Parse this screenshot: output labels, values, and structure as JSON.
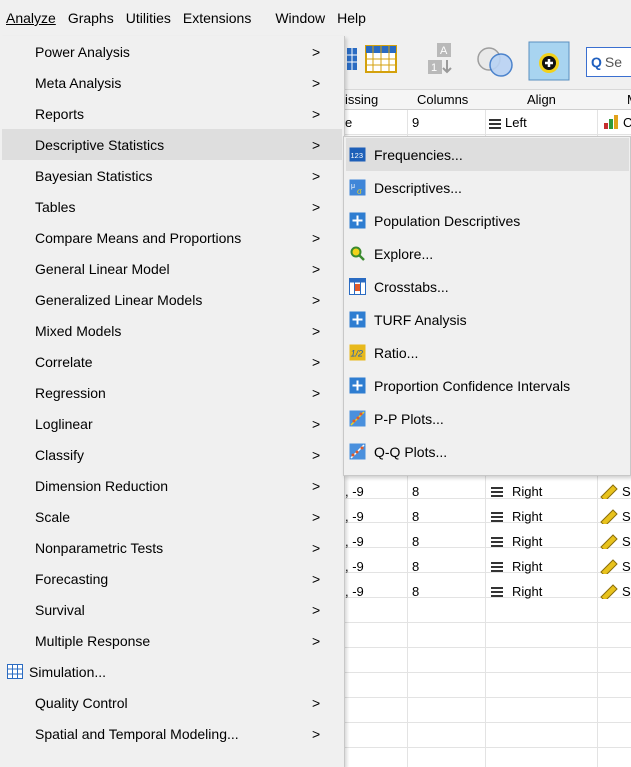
{
  "menubar": {
    "items": [
      "Analyze",
      "Graphs",
      "Utilities",
      "Extensions",
      "Window",
      "Help"
    ]
  },
  "toolbar": {
    "search_placeholder": "Se"
  },
  "grid": {
    "headers": [
      "issing",
      "Columns",
      "Align",
      "M"
    ],
    "first_row": {
      "missing": "e",
      "columns": "9",
      "align": "Left",
      "measure": "C"
    },
    "rows": [
      {
        "missing": ", -9",
        "columns": "8",
        "align": "Right",
        "measure": "S"
      },
      {
        "missing": ", -9",
        "columns": "8",
        "align": "Right",
        "measure": "S"
      },
      {
        "missing": ", -9",
        "columns": "8",
        "align": "Right",
        "measure": "S"
      },
      {
        "missing": ", -9",
        "columns": "8",
        "align": "Right",
        "measure": "S"
      },
      {
        "missing": ", -9",
        "columns": "8",
        "align": "Right",
        "measure": "S"
      }
    ]
  },
  "analyze_menu": {
    "items": [
      {
        "label": "Power Analysis",
        "submenu": true
      },
      {
        "label": "Meta Analysis",
        "submenu": true
      },
      {
        "label": "Reports",
        "submenu": true
      },
      {
        "label": "Descriptive Statistics",
        "submenu": true,
        "highlighted": true
      },
      {
        "label": "Bayesian Statistics",
        "submenu": true
      },
      {
        "label": "Tables",
        "submenu": true
      },
      {
        "label": "Compare Means and Proportions",
        "submenu": true
      },
      {
        "label": "General Linear Model",
        "submenu": true
      },
      {
        "label": "Generalized Linear Models",
        "submenu": true
      },
      {
        "label": "Mixed Models",
        "submenu": true
      },
      {
        "label": "Correlate",
        "submenu": true
      },
      {
        "label": "Regression",
        "submenu": true
      },
      {
        "label": "Loglinear",
        "submenu": true
      },
      {
        "label": "Classify",
        "submenu": true
      },
      {
        "label": "Dimension Reduction",
        "submenu": true
      },
      {
        "label": "Scale",
        "submenu": true
      },
      {
        "label": "Nonparametric Tests",
        "submenu": true
      },
      {
        "label": "Forecasting",
        "submenu": true
      },
      {
        "label": "Survival",
        "submenu": true
      },
      {
        "label": "Multiple Response",
        "submenu": true
      },
      {
        "label": "Simulation...",
        "submenu": false,
        "icon": "simulation-icon"
      },
      {
        "label": "Quality Control",
        "submenu": true
      },
      {
        "label": "Spatial and Temporal Modeling...",
        "submenu": true
      }
    ],
    "arrow": ">"
  },
  "descriptive_submenu": {
    "items": [
      {
        "label": "Frequencies...",
        "icon": "frequencies-icon",
        "highlighted": true
      },
      {
        "label": "Descriptives...",
        "icon": "descriptives-icon"
      },
      {
        "label": "Population Descriptives",
        "icon": "plus-icon"
      },
      {
        "label": "Explore...",
        "icon": "explore-icon"
      },
      {
        "label": "Crosstabs...",
        "icon": "crosstabs-icon"
      },
      {
        "label": "TURF Analysis",
        "icon": "plus-icon"
      },
      {
        "label": "Ratio...",
        "icon": "ratio-icon"
      },
      {
        "label": "Proportion Confidence Intervals",
        "icon": "plus-icon"
      },
      {
        "label": "P-P Plots...",
        "icon": "pp-plots-icon"
      },
      {
        "label": "Q-Q Plots...",
        "icon": "qq-plots-icon"
      }
    ]
  },
  "colors": {
    "menu_bg": "#f0f0f0",
    "highlight": "#dedede",
    "plus_blue": "#2e7dd1",
    "search_border": "#3a6fd0"
  }
}
